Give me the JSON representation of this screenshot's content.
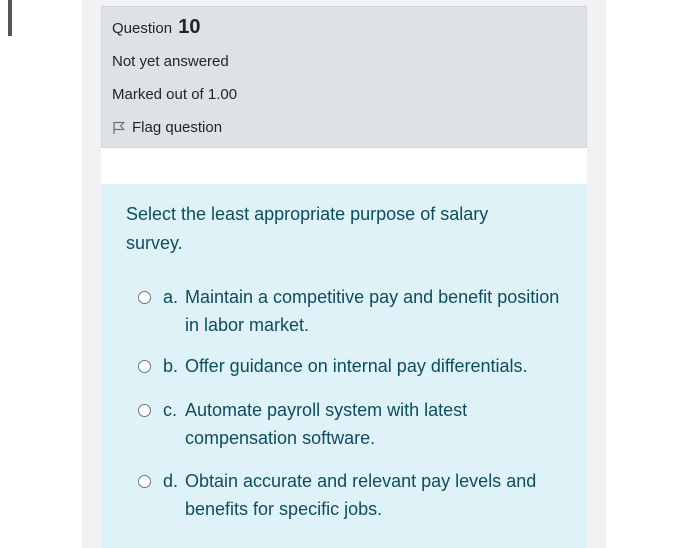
{
  "info": {
    "question_label": "Question",
    "question_number": "10",
    "state": "Not yet answered",
    "grade": "Marked out of 1.00",
    "flag_label": "Flag question"
  },
  "question": {
    "text": "Select the least appropriate purpose of salary survey.",
    "answers": [
      {
        "letter": "a.",
        "text": "Maintain a competitive pay and benefit position in labor market."
      },
      {
        "letter": "b.",
        "text": "Offer guidance on internal pay differentials."
      },
      {
        "letter": "c.",
        "text": "Automate payroll system with latest compensation software."
      },
      {
        "letter": "d.",
        "text": "Obtain accurate and relevant pay levels and benefits for specific jobs."
      }
    ]
  },
  "colors": {
    "info_bg": "#dee2e6",
    "content_bg": "#def2f8",
    "content_text": "#0f4d5a"
  },
  "icons": {
    "flag": "flag-icon",
    "radio": "radio-icon"
  }
}
